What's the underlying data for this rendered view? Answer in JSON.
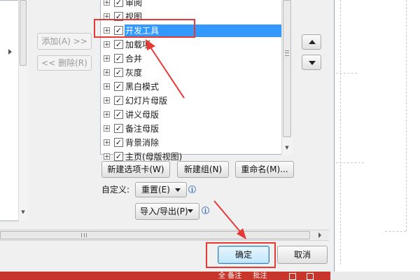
{
  "dialog": {
    "add_button": "添加(A) >>",
    "remove_button": "<< 删除(R)",
    "tree_items": [
      {
        "label": "审阅",
        "checked": true,
        "selected": false
      },
      {
        "label": "视图",
        "checked": true,
        "selected": false
      },
      {
        "label": "开发工具",
        "checked": true,
        "selected": true
      },
      {
        "label": "加载项",
        "checked": true,
        "selected": false
      },
      {
        "label": "合并",
        "checked": true,
        "selected": false
      },
      {
        "label": "灰度",
        "checked": true,
        "selected": false
      },
      {
        "label": "黑白模式",
        "checked": true,
        "selected": false
      },
      {
        "label": "幻灯片母版",
        "checked": true,
        "selected": false
      },
      {
        "label": "讲义母版",
        "checked": true,
        "selected": false
      },
      {
        "label": "备注母版",
        "checked": true,
        "selected": false
      },
      {
        "label": "背景消除",
        "checked": true,
        "selected": false
      },
      {
        "label": "主页(母版视图)",
        "checked": true,
        "selected": false
      }
    ],
    "new_tab_button": "新建选项卡(W)",
    "new_group_button": "新建组(N)",
    "rename_button": "重命名(M)...",
    "customize_label": "自定义:",
    "reset_button": "重置(E)",
    "import_export_button": "导入/导出(P)",
    "ok_button": "确定",
    "cancel_button": "取消"
  },
  "taskbar": {
    "text": "    全 备注   批注"
  },
  "icons": {
    "expander": "plus-expander-icon",
    "checkbox": "check-icon",
    "info": "info-icon",
    "move_up": "triangle-up-icon",
    "move_down": "triangle-down-icon"
  },
  "colors": {
    "selection": "#3399ff",
    "annotation": "#e53935",
    "taskbar": "#c8352a"
  }
}
